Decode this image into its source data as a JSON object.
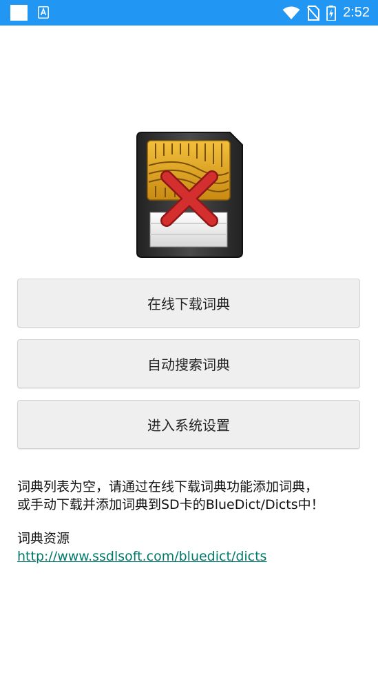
{
  "status_bar": {
    "time": "2:52",
    "icons": [
      "notification-square-icon",
      "translate-a-icon",
      "wifi-icon",
      "no-sim-icon",
      "battery-charging-icon"
    ]
  },
  "illustration": {
    "icon": "sd-card-missing-icon",
    "colors": {
      "card_body": "#3a3a3a",
      "chip_gold": "#e0a320",
      "cross_red": "#c62828",
      "label_white": "#f2f2f2"
    }
  },
  "buttons": {
    "download_online": "在线下载词典",
    "auto_search": "自动搜索词典",
    "system_settings": "进入系统设置"
  },
  "message": {
    "line1": "词典列表为空，请通过在线下载词典功能添加词典，",
    "line2": "或手动下载并添加词典到SD卡的BlueDict/Dicts中！"
  },
  "resources": {
    "title": "词典资源",
    "link": "http://www.ssdlsoft.com/bluedict/dicts"
  },
  "colors": {
    "status_bar": "#2196f3",
    "link": "#00796b",
    "button_bg": "#efefef"
  }
}
